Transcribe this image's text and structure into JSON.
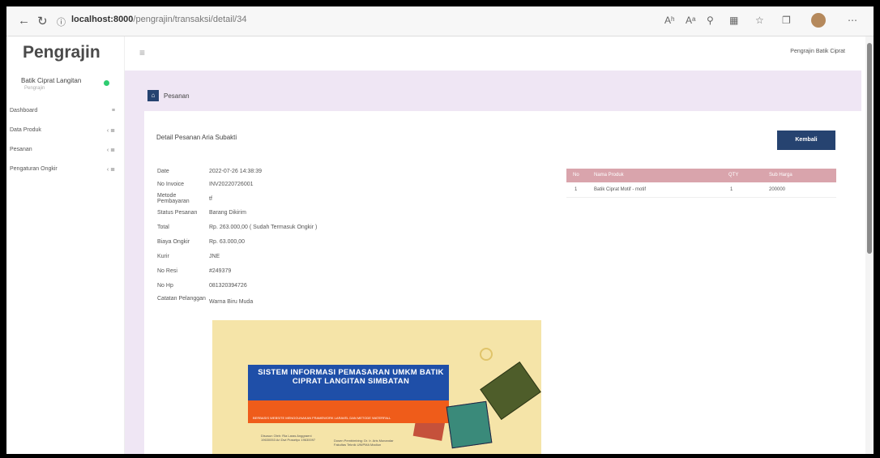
{
  "browser": {
    "url_host": "localhost:8000",
    "url_path": "/pengrajin/transaksi/detail/34",
    "reader_label": "Aʰ",
    "zoom_label": "Aᵃ"
  },
  "sidebar": {
    "brand": "Pengrajin",
    "user_name": "Batik Ciprat Langitan",
    "user_sub": "Pengrajin",
    "items": [
      {
        "label": "Dashboard",
        "badge": "≡"
      },
      {
        "label": "Data Produk",
        "badge": "‹ ≣"
      },
      {
        "label": "Pesanan",
        "badge": "‹ ≣"
      },
      {
        "label": "Pengaturan Ongkir",
        "badge": "‹ ≣"
      }
    ]
  },
  "topbar": {
    "user": "Pengrajin Batik Ciprat"
  },
  "section": {
    "title": "Pesanan"
  },
  "card": {
    "title": "Detail Pesanan Aria Subakti",
    "back_button": "Kembali",
    "details": [
      {
        "key": "Date",
        "value": "2022-07-26 14:38:39"
      },
      {
        "key": "No Invoice",
        "value": "INV20220726001"
      },
      {
        "key": "Metode Pembayaran",
        "value": "tf"
      },
      {
        "key": "Status Pesanan",
        "value": "Barang Dikirim"
      },
      {
        "key": "Total",
        "value": "Rp. 263.000,00 ( Sudah Termasuk Ongkir )"
      },
      {
        "key": "Biaya Ongkir",
        "value": "Rp. 63.000,00"
      },
      {
        "key": "Kurir",
        "value": "JNE"
      },
      {
        "key": "No Resi",
        "value": "#249379"
      },
      {
        "key": "No Hp",
        "value": "081320394726"
      },
      {
        "key": "Catatan Pelanggan",
        "value": "Warna Biru Muda"
      }
    ]
  },
  "table": {
    "headers": [
      "No",
      "Nama Produk",
      "QTY",
      "Sub Harga"
    ],
    "rows": [
      [
        "1",
        "Batik Ciprat Motif - motif",
        "1",
        "200000"
      ]
    ]
  },
  "poster": {
    "title": "SISTEM INFORMASI PEMASARAN UMKM BATIK CIPRAT LANGITAN SIMBATAN",
    "subtitle": "BERBASIS WEBSITE MENGGUNAKAN FRAMEWORK LARAVEL DAN METODE WATERFALL",
    "left_text": "Disusun Oleh: Ria Laras Anggraeni 19630053 Ari Dwi Prasetyo 19630097",
    "right_text": "Dosen Pembimbing: Dr. Ir. Aris Munandar Fakultas Teknik UNIPMA Madiun"
  },
  "colors": {
    "primary": "#264370",
    "table_header": "#d9a4ac",
    "bg_main": "#efe6f4",
    "online": "#2ecc71"
  }
}
